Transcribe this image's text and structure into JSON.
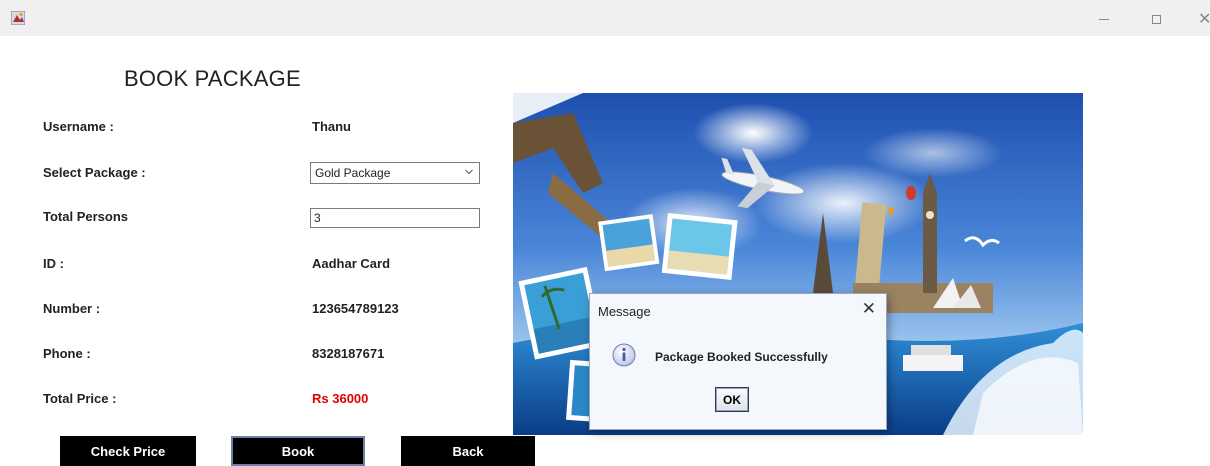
{
  "window": {
    "icons": {
      "app": "app-icon",
      "minimize": "minimize-icon",
      "maximize": "maximize-icon",
      "close": "close-icon"
    }
  },
  "page": {
    "title": "BOOK PACKAGE"
  },
  "form": {
    "username_label": "Username :",
    "username_value": "Thanu",
    "package_label": "Select Package :",
    "package_selected": "Gold Package",
    "persons_label": "Total Persons",
    "persons_value": "3",
    "id_label": "ID :",
    "id_value": "Aadhar Card",
    "number_label": "Number :",
    "number_value": "123654789123",
    "phone_label": "Phone :",
    "phone_value": "8328187671",
    "price_label": "Total Price :",
    "price_value": "Rs 36000",
    "price_color": "#e00000"
  },
  "buttons": {
    "check_price": "Check Price",
    "book": "Book",
    "back": "Back"
  },
  "dialog": {
    "title": "Message",
    "close_symbol": "✕",
    "message": "Package Booked Successfully",
    "ok_label": "OK",
    "icon": "info-icon"
  },
  "colors": {
    "button_bg": "#000000",
    "button_text": "#ffffff",
    "titlebar_bg": "#f0f0f0",
    "dialog_bg": "#f4f7fc"
  }
}
